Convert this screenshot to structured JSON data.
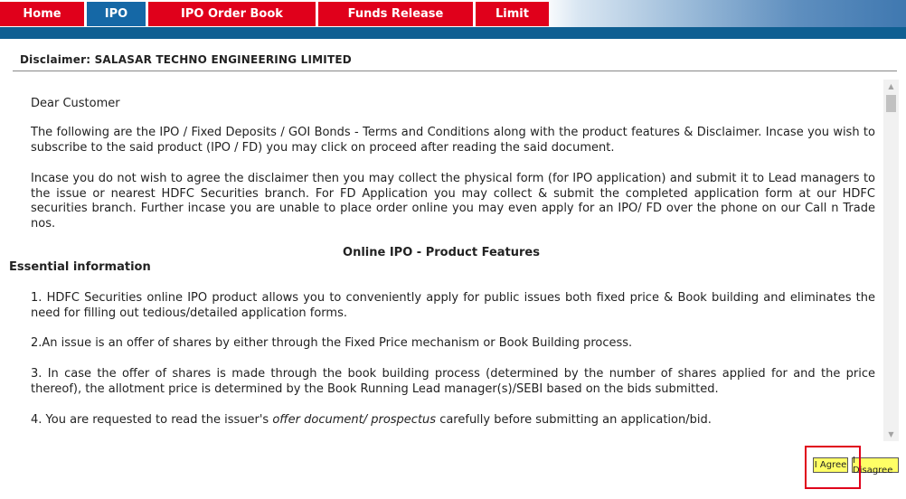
{
  "nav": {
    "tabs": [
      {
        "label": "Home",
        "active": false
      },
      {
        "label": "IPO",
        "active": true
      },
      {
        "label": "IPO Order Book",
        "active": false
      },
      {
        "label": "Funds Release",
        "active": false
      },
      {
        "label": "Limit",
        "active": false
      }
    ]
  },
  "disclaimer": {
    "title": "Disclaimer: SALASAR TECHNO ENGINEERING LIMITED"
  },
  "content": {
    "greeting": "Dear Customer",
    "para1": "The following are the IPO / Fixed Deposits / GOI Bonds - Terms and Conditions along with the product features & Disclaimer. Incase you wish to subscribe to the said product (IPO / FD) you may click on proceed after reading the said document.",
    "para2": "Incase you do not wish to agree the disclaimer then you may collect the physical form (for IPO application) and submit it to Lead managers to the issue or nearest HDFC Securities branch. For FD Application you may collect & submit the completed application form at our HDFC securities branch. Further incase you are unable to place order online you may even apply for an IPO/ FD over the phone on our Call n Trade nos.",
    "features_heading": "Online IPO - Product Features",
    "essential_heading": "Essential information",
    "item1": "1. HDFC Securities online IPO product allows you to conveniently apply for public issues both fixed price & Book building and eliminates the need for filling out tedious/detailed application forms.",
    "item2": "2.An issue is an offer of shares by either through the Fixed Price mechanism or Book Building process.",
    "item3": "3. In case the offer of shares is made through the book building process (determined by the number of shares applied for and the price thereof), the allotment price is determined by the Book Running Lead manager(s)/SEBI based on the bids submitted.",
    "item4_prefix": "4. You are requested to read the issuer's ",
    "item4_emph": "offer document/ prospectus",
    "item4_suffix": " carefully before submitting an application/bid."
  },
  "buttons": {
    "agree": "I Agree",
    "disagree": "I Disagree"
  },
  "colors": {
    "tab_red": "#e0001b",
    "tab_active_blue": "#1568a6",
    "nav_bar_blue": "#0f5f92",
    "button_yellow": "#ffff66",
    "highlight_red": "#e0001b"
  }
}
